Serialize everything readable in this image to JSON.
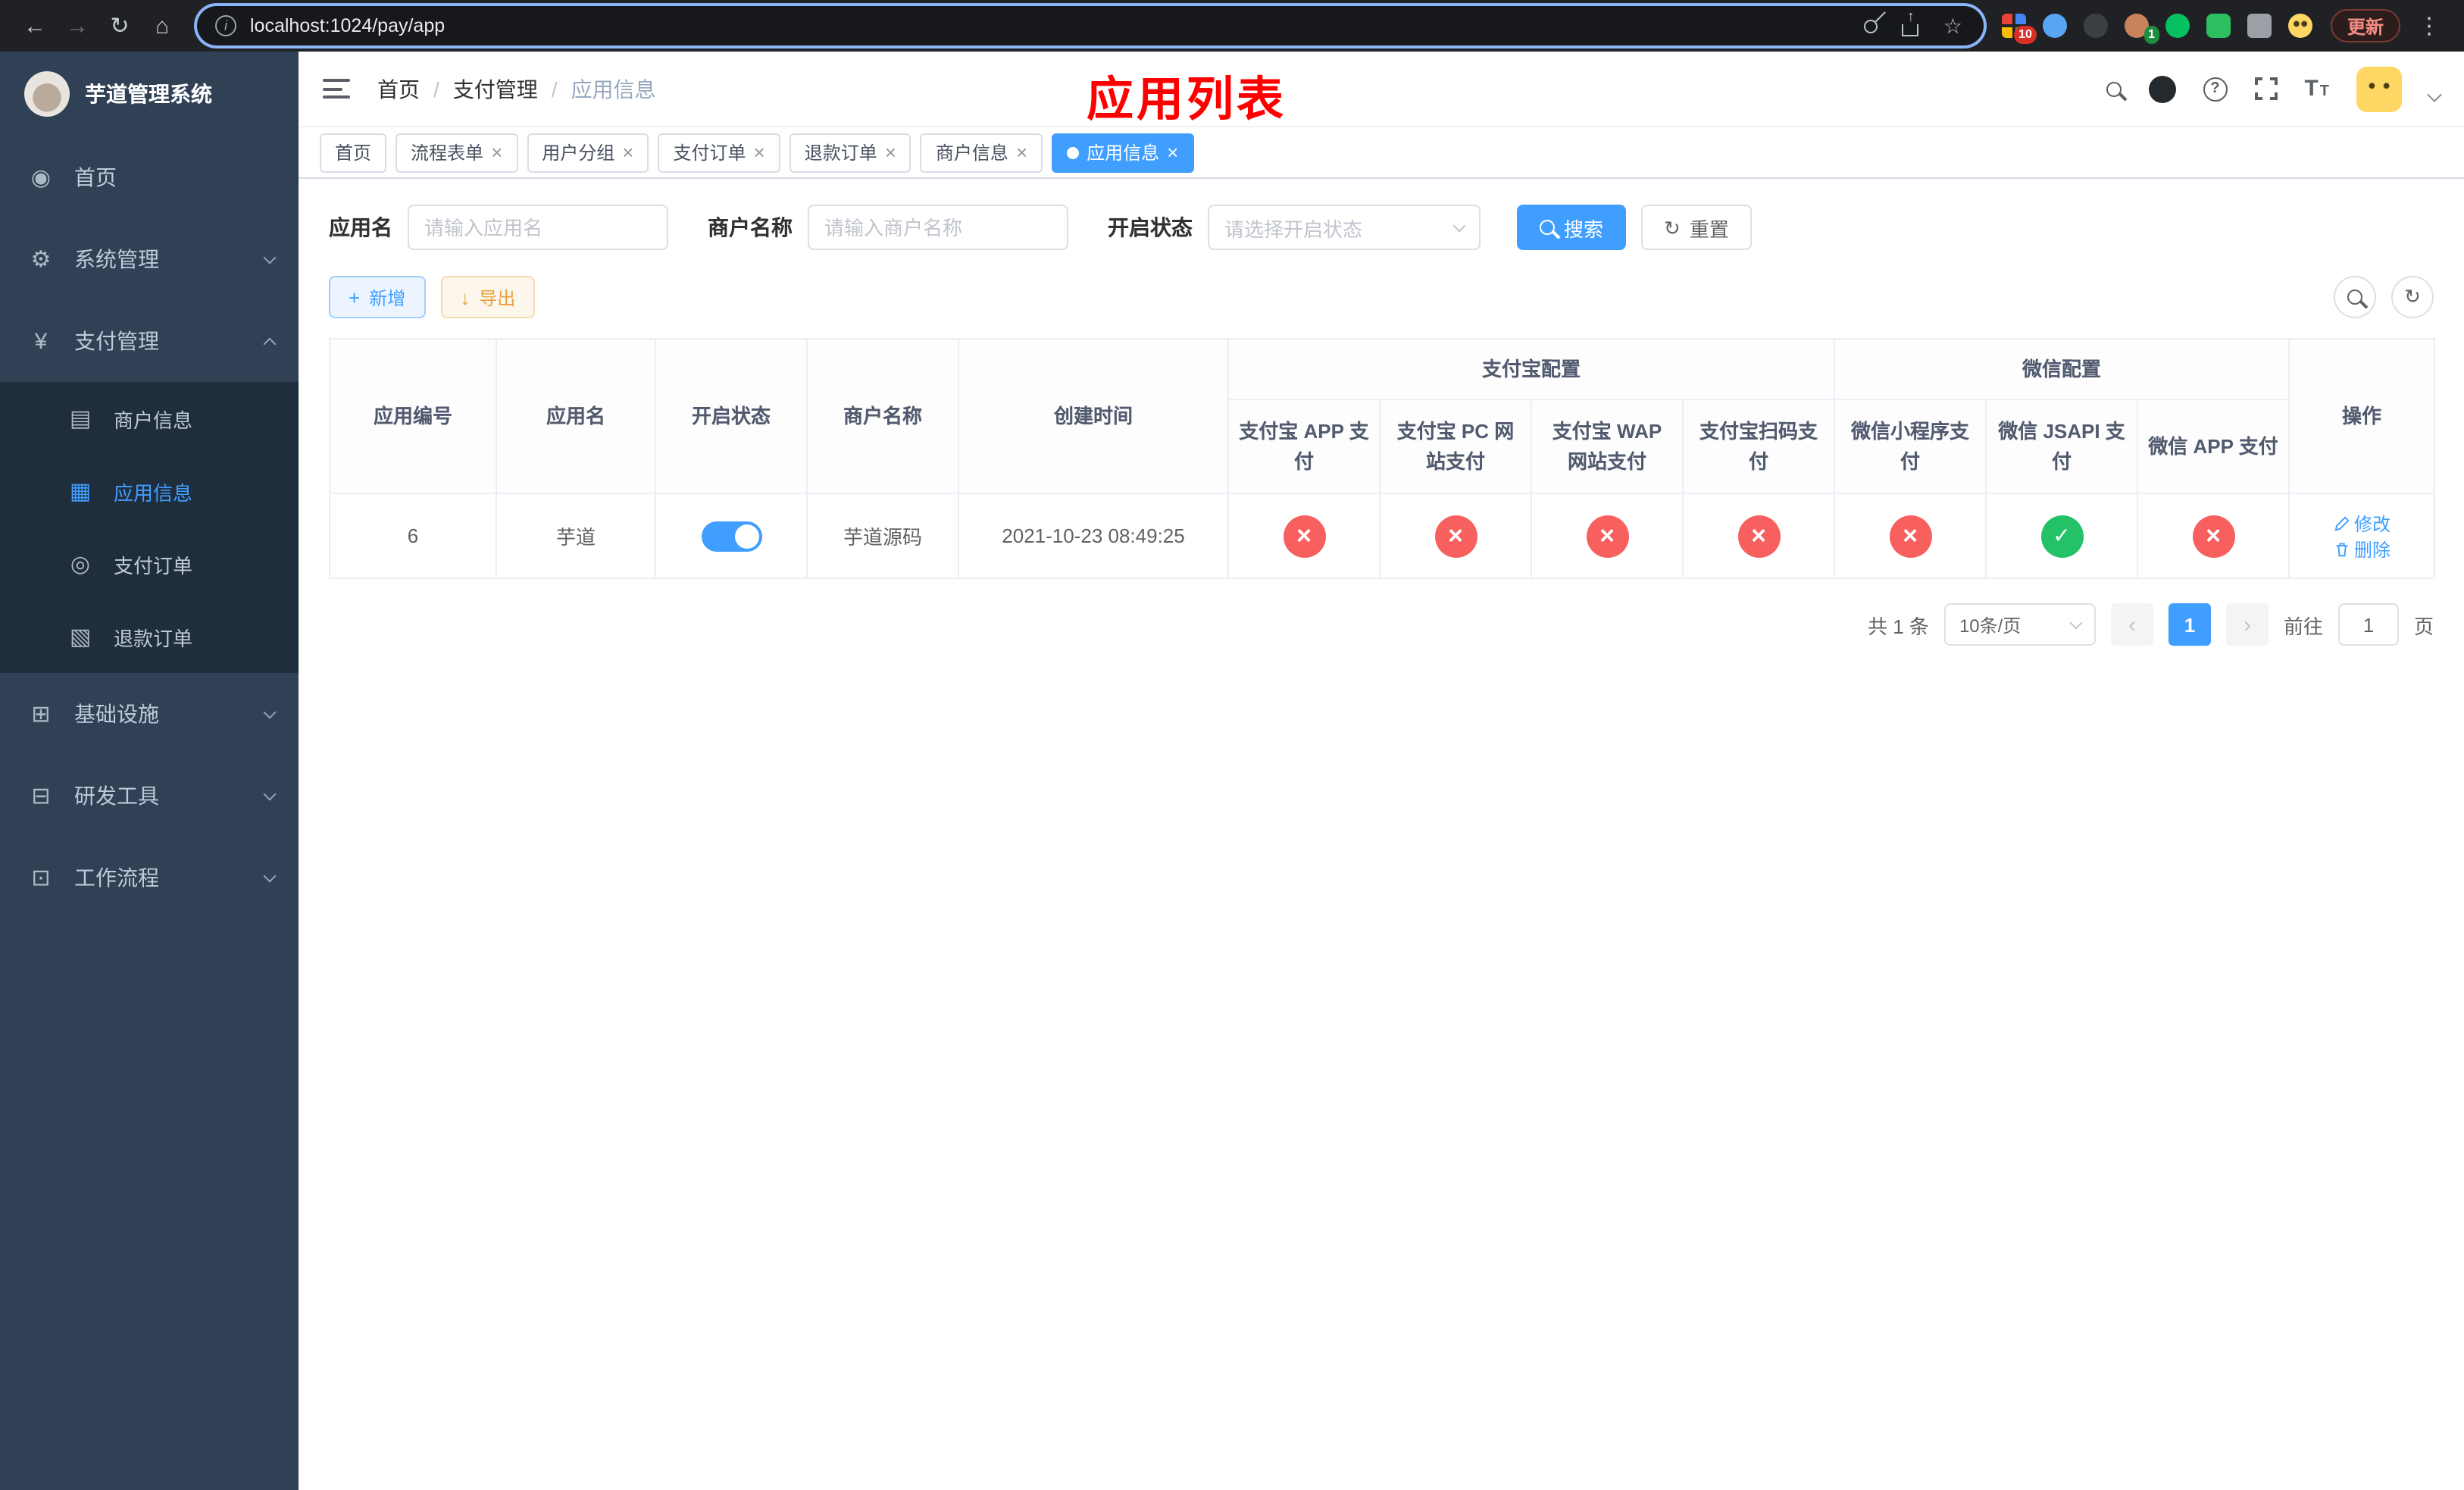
{
  "colors": {
    "primary": "#409eff",
    "success": "#23c268",
    "danger": "#f7605f",
    "sidebar_bg": "#304156",
    "submenu_bg": "#1f2d3d",
    "annotation_red": "#fe0000"
  },
  "browser": {
    "url": "localhost:1024/pay/app",
    "update_button": "更新",
    "extension_badge_grid": "10",
    "extension_badge_translate": "1"
  },
  "icons": {
    "back": "←",
    "forward": "→",
    "reload": "↻",
    "home": "⌂",
    "star": "☆",
    "menu_dots": "⋮",
    "dashboard": "◉",
    "gear": "⚙",
    "yen": "¥",
    "merchant": "▤",
    "app": "▦",
    "order": "◎",
    "refund": "▧",
    "infra": "⊞",
    "tools": "⊟",
    "workflow": "⊡",
    "plus": "+",
    "download": "↓",
    "refresh": "↻",
    "prev": "‹",
    "next": "›"
  },
  "sidebar": {
    "logo_title": "芋道管理系统",
    "home": "首页",
    "system": "系统管理",
    "payment": "支付管理",
    "merchant_info": "商户信息",
    "app_info": "应用信息",
    "pay_order": "支付订单",
    "refund_order": "退款订单",
    "infra": "基础设施",
    "dev_tools": "研发工具",
    "workflow": "工作流程"
  },
  "navbar": {
    "breadcrumb": [
      "首页",
      "支付管理",
      "应用信息"
    ],
    "overlay_title": "应用列表"
  },
  "tabs": [
    {
      "label": "首页",
      "closable": false,
      "active": false
    },
    {
      "label": "流程表单",
      "closable": true,
      "active": false
    },
    {
      "label": "用户分组",
      "closable": true,
      "active": false
    },
    {
      "label": "支付订单",
      "closable": true,
      "active": false
    },
    {
      "label": "退款订单",
      "closable": true,
      "active": false
    },
    {
      "label": "商户信息",
      "closable": true,
      "active": false
    },
    {
      "label": "应用信息",
      "closable": true,
      "active": true
    }
  ],
  "filters": {
    "app_name_label": "应用名",
    "app_name_placeholder": "请输入应用名",
    "merchant_name_label": "商户名称",
    "merchant_name_placeholder": "请输入商户名称",
    "status_label": "开启状态",
    "status_placeholder": "请选择开启状态",
    "search_button": "搜索",
    "reset_button": "重置"
  },
  "toolbar": {
    "add_button": "新增",
    "export_button": "导出"
  },
  "table": {
    "group_alipay": "支付宝配置",
    "group_wechat": "微信配置",
    "plain_headers": [
      "应用编号",
      "应用名",
      "开启状态",
      "商户名称",
      "创建时间"
    ],
    "alipay_headers": [
      "支付宝 APP 支付",
      "支付宝 PC 网站支付",
      "支付宝 WAP 网站支付",
      "支付宝扫码支付"
    ],
    "wechat_headers": [
      "微信小程序支付",
      "微信 JSAPI 支付",
      "微信 APP 支付"
    ],
    "action_header": "操作",
    "rows": [
      {
        "app_id": "6",
        "app_name": "芋道",
        "status": "on",
        "merchant_name": "芋道源码",
        "create_time": "2021-10-23 08:49:25",
        "alipay_app": "disabled",
        "alipay_pc": "disabled",
        "alipay_wap": "disabled",
        "alipay_qr": "disabled",
        "wechat_mini": "disabled",
        "wechat_jsapi": "enabled",
        "wechat_app": "disabled",
        "edit_label": "修改",
        "delete_label": "删除"
      }
    ]
  },
  "pagination": {
    "total_text": "共 1 条",
    "page_size": "10条/页",
    "current_page": "1",
    "goto_label": "前往",
    "goto_value": "1",
    "goto_suffix": "页"
  }
}
